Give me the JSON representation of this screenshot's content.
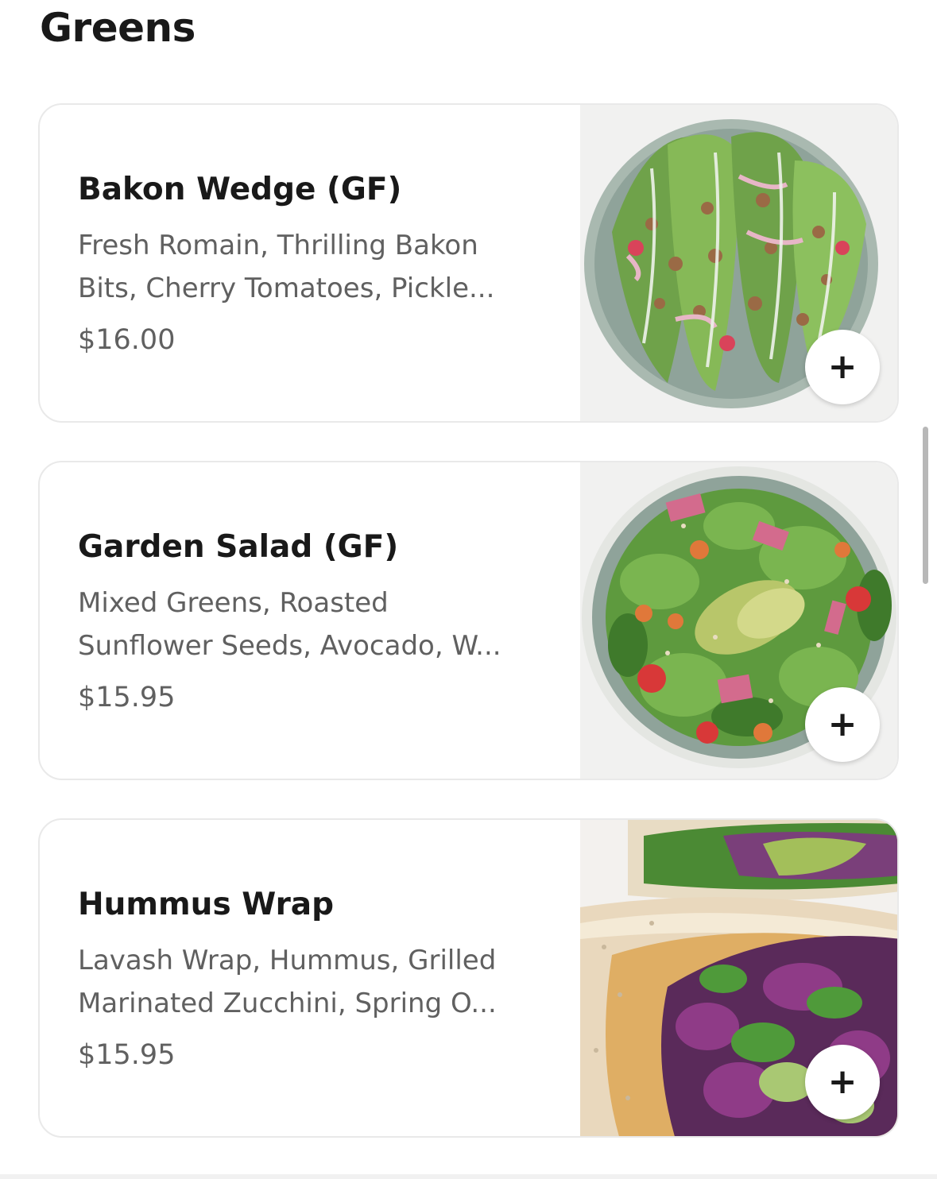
{
  "section": {
    "title": "Greens"
  },
  "items": [
    {
      "name": "Bakon Wedge (GF)",
      "description": "Fresh Romain, Thrilling Bakon\nBits, Cherry Tomatoes, Pickle...",
      "price": "$16.00",
      "add_icon": "plus-icon",
      "photo": "salad-photo"
    },
    {
      "name": "Garden Salad (GF)",
      "description": "Mixed Greens, Roasted\nSunflower Seeds, Avocado, W...",
      "price": "$15.95",
      "add_icon": "plus-icon",
      "photo": "salad-photo"
    },
    {
      "name": "Hummus Wrap",
      "description": "Lavash Wrap, Hummus, Grilled\nMarinated Zucchini, Spring O...",
      "price": "$15.95",
      "add_icon": "plus-icon",
      "photo": "wrap-photo"
    }
  ],
  "icons": {
    "add": "+"
  },
  "colors": {
    "text_primary": "#191919",
    "text_secondary": "#606060",
    "card_border": "#e9e9e9",
    "plate": "#8fa39a"
  }
}
